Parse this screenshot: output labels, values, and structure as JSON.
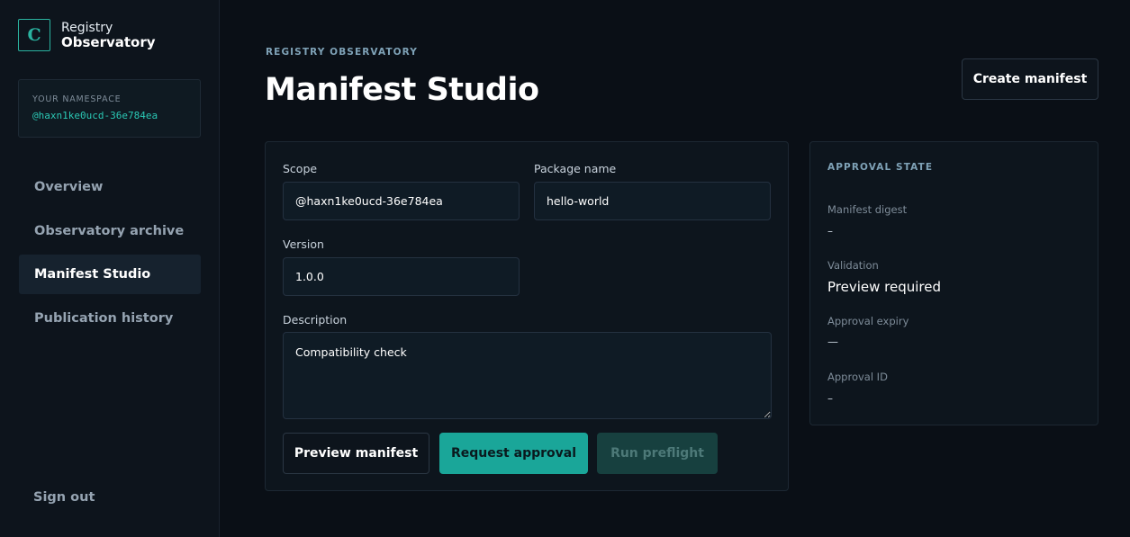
{
  "brand": {
    "logo_letter": "C",
    "line1": "Registry",
    "line2": "Observatory"
  },
  "namespace": {
    "label": "YOUR NAMESPACE",
    "value": "@haxn1ke0ucd-36e784ea"
  },
  "nav": {
    "items": [
      {
        "label": "Overview",
        "active": false
      },
      {
        "label": "Observatory archive",
        "active": false
      },
      {
        "label": "Manifest Studio",
        "active": true
      },
      {
        "label": "Publication history",
        "active": false
      }
    ],
    "sign_out": "Sign out"
  },
  "header": {
    "eyebrow": "REGISTRY OBSERVATORY",
    "title": "Manifest Studio",
    "create_button": "Create manifest"
  },
  "form": {
    "scope": {
      "label": "Scope",
      "value": "@haxn1ke0ucd-36e784ea"
    },
    "package_name": {
      "label": "Package name",
      "value": "hello-world"
    },
    "version": {
      "label": "Version",
      "value": "1.0.0"
    },
    "description": {
      "label": "Description",
      "value": "Compatibility check"
    },
    "buttons": {
      "preview": "Preview manifest",
      "request": "Request approval",
      "preflight": "Run preflight"
    }
  },
  "approval": {
    "title": "APPROVAL STATE",
    "digest": {
      "label": "Manifest digest",
      "value": "–"
    },
    "validation": {
      "label": "Validation",
      "value": "Preview required"
    },
    "expiry": {
      "label": "Approval expiry",
      "value": "—"
    },
    "id": {
      "label": "Approval ID",
      "value": "–"
    }
  },
  "colors": {
    "accent": "#1aa699",
    "background": "#0a0f16",
    "sidebar": "#0d141c"
  }
}
